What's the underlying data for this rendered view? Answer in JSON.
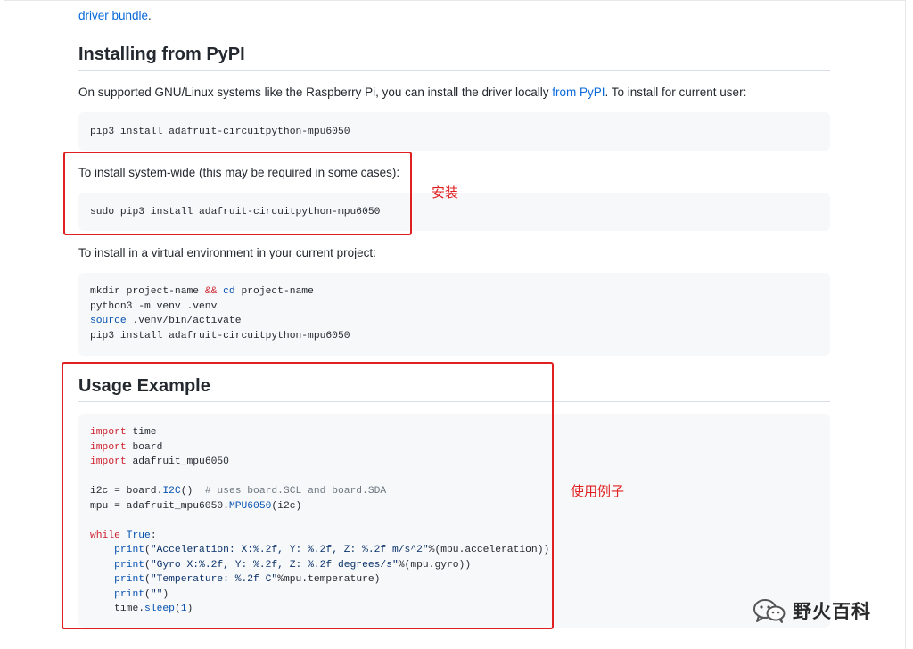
{
  "top_link": {
    "text": "driver bundle",
    "suffix": "."
  },
  "pypi_section": {
    "heading": "Installing from PyPI",
    "intro_before": "On supported GNU/Linux systems like the Raspberry Pi, you can install the driver locally ",
    "intro_link": "from PyPI",
    "intro_after": ". To install for current user:",
    "user_cmd": "pip3 install adafruit-circuitpython-mpu6050",
    "system_label": "To install system-wide (this may be required in some cases):",
    "system_cmd": "sudo pip3 install adafruit-circuitpython-mpu6050",
    "venv_label": "To install in a virtual environment in your current project:",
    "venv_code": {
      "l1_a": "mkdir project-name ",
      "l1_op": "&&",
      "l1_sp": " ",
      "l1_cd": "cd",
      "l1_b": " project-name",
      "l2": "python3 -m venv .venv",
      "l3_src": "source",
      "l3_b": " .venv/bin/activate",
      "l4": "pip3 install adafruit-circuitpython-mpu6050"
    }
  },
  "usage_section": {
    "heading": "Usage Example",
    "code": {
      "import": "import",
      "time": " time",
      "board": " board",
      "mpu_mod": " adafruit_mpu6050",
      "i2c_a": "i2c = board.",
      "i2c_fn": "I2C",
      "i2c_b": "()  ",
      "i2c_cm": "# uses board.SCL and board.SDA",
      "mpu_a": "mpu = adafruit_mpu6050.",
      "mpu_fn": "MPU6050",
      "mpu_b": "(i2c)",
      "while": "while",
      "sp": " ",
      "true": "True",
      "colon": ":",
      "indent": "    ",
      "print": "print",
      "p1_str": "\"Acceleration: X:%.2f, Y: %.2f, Z: %.2f m/s^2\"",
      "p1_rest": "%(mpu.acceleration))",
      "p2_str": "\"Gyro X:%.2f, Y: %.2f, Z: %.2f degrees/s\"",
      "p2_rest": "%(mpu.gyro))",
      "p3_str": "\"Temperature: %.2f C\"",
      "p3_rest": "%mpu.temperature)",
      "p4_str": "\"\"",
      "p4_rest": ")",
      "open": "(",
      "sleep_a": "time.",
      "sleep_fn": "sleep",
      "sleep_b": "(",
      "sleep_n": "1",
      "sleep_c": ")"
    }
  },
  "annotations": {
    "install_label": "安装",
    "usage_label": "使用例子",
    "color": "#e02020"
  },
  "watermark": {
    "text": "野火百科",
    "icon": "wechat-icon"
  }
}
